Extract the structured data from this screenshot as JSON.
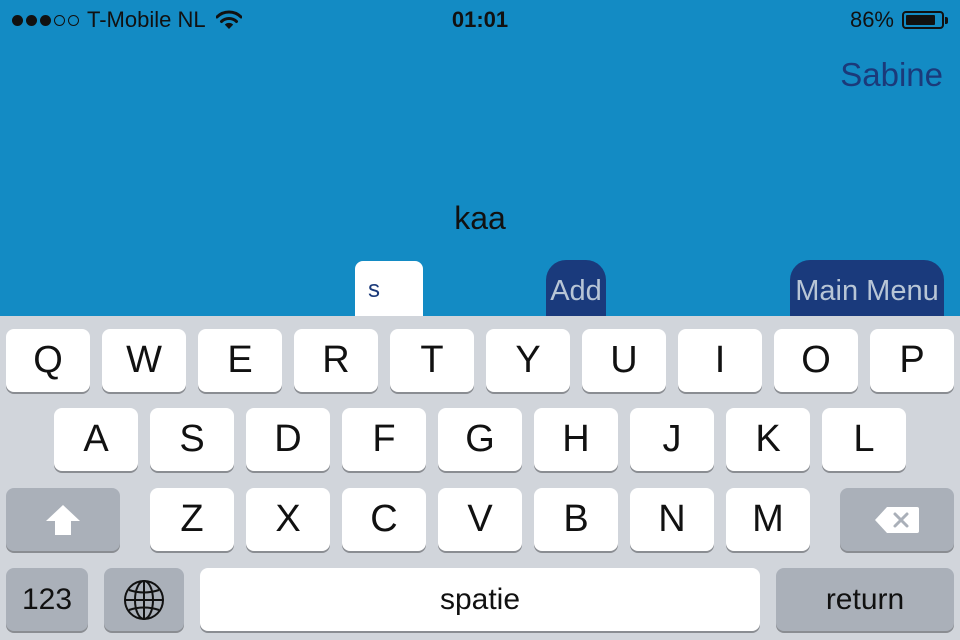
{
  "status_bar": {
    "signal_dots": [
      true,
      true,
      true,
      false,
      false
    ],
    "carrier": "T-Mobile NL",
    "time": "01:01",
    "battery_percent_label": "86%",
    "battery_level": 0.86
  },
  "user": {
    "name": "Sabine"
  },
  "word": "kaa",
  "letter_input": {
    "value": "s"
  },
  "buttons": {
    "add": "Add",
    "main_menu": "Main Menu"
  },
  "keyboard": {
    "row1": [
      "Q",
      "W",
      "E",
      "R",
      "T",
      "Y",
      "U",
      "I",
      "O",
      "P"
    ],
    "row2": [
      "A",
      "S",
      "D",
      "F",
      "G",
      "H",
      "J",
      "K",
      "L"
    ],
    "row3": [
      "Z",
      "X",
      "C",
      "V",
      "B",
      "N",
      "M"
    ],
    "numbers_key": "123",
    "space_key": "spatie",
    "return_key": "return",
    "shift_icon": "shift-icon",
    "globe_icon": "globe-icon",
    "backspace_icon": "backspace-icon"
  },
  "colors": {
    "app_background": "#138bc4",
    "button_background": "#1a3a7c",
    "user_name": "#1b3a7a",
    "keyboard_background": "#d1d5db"
  }
}
